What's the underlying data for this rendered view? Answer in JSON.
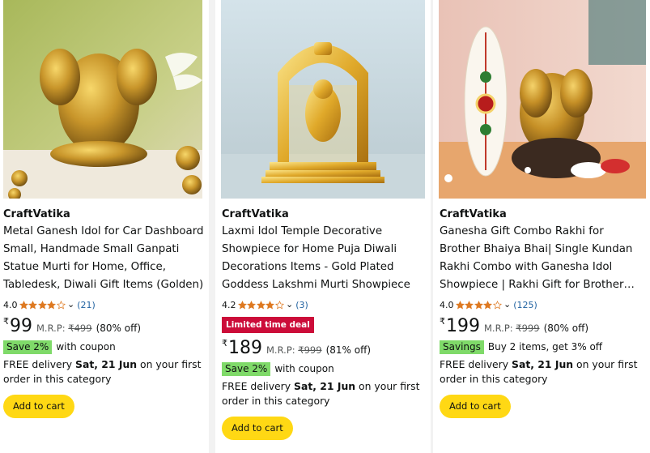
{
  "products": [
    {
      "brand": "CraftVatika",
      "title": "Metal Ganesh Idol for Car Dashboard Small, Handmade Small Ganpati Statue Murti for Home, Office, Tabledesk, Diwali Gift Items (Golden)",
      "rating": "4.0",
      "stars": 4.0,
      "review_count": "(21)",
      "deal_badge": "",
      "currency": "₹",
      "price": "99",
      "mrp_label": "M.R.P:",
      "mrp": "₹499",
      "discount": "(80% off)",
      "coupon_badge": "Save 2%",
      "coupon_text": "with coupon",
      "delivery_prefix": "FREE delivery",
      "delivery_date": "Sat, 21 Jun",
      "delivery_suffix": "on your first order in this category",
      "cart_label": "Add to cart"
    },
    {
      "brand": "CraftVatika",
      "title": "Laxmi Idol Temple Decorative Showpiece for Home Puja Diwali Decorations Items - Gold Plated Goddess Lakshmi Murti Showpiece",
      "rating": "4.2",
      "stars": 4.2,
      "review_count": "(3)",
      "deal_badge": "Limited time deal",
      "currency": "₹",
      "price": "189",
      "mrp_label": "M.R.P:",
      "mrp": "₹999",
      "discount": "(81% off)",
      "coupon_badge": "Save 2%",
      "coupon_text": "with coupon",
      "delivery_prefix": "FREE delivery",
      "delivery_date": "Sat, 21 Jun",
      "delivery_suffix": "on your first order in this category",
      "cart_label": "Add to cart"
    },
    {
      "brand": "CraftVatika",
      "title": "Ganesha Gift Combo Rakhi for Brother Bhaiya Bhai| Single Kundan Rakhi Combo with Ganesha Idol Showpiece | Rakhi Gift for Brother and Bhabhi",
      "rating": "4.0",
      "stars": 4.0,
      "review_count": "(125)",
      "deal_badge": "",
      "currency": "₹",
      "price": "199",
      "mrp_label": "M.R.P:",
      "mrp": "₹999",
      "discount": "(80% off)",
      "coupon_badge": "Savings",
      "coupon_text": "Buy 2 items, get 3% off",
      "delivery_prefix": "FREE delivery",
      "delivery_date": "Sat, 21 Jun",
      "delivery_suffix": "on your first order in this category",
      "cart_label": "Add to cart"
    }
  ],
  "colors": {
    "star": "#de7921",
    "link": "#2162a1",
    "deal": "#cc0c39",
    "coupon": "#7fda69",
    "cart": "#ffd814"
  }
}
